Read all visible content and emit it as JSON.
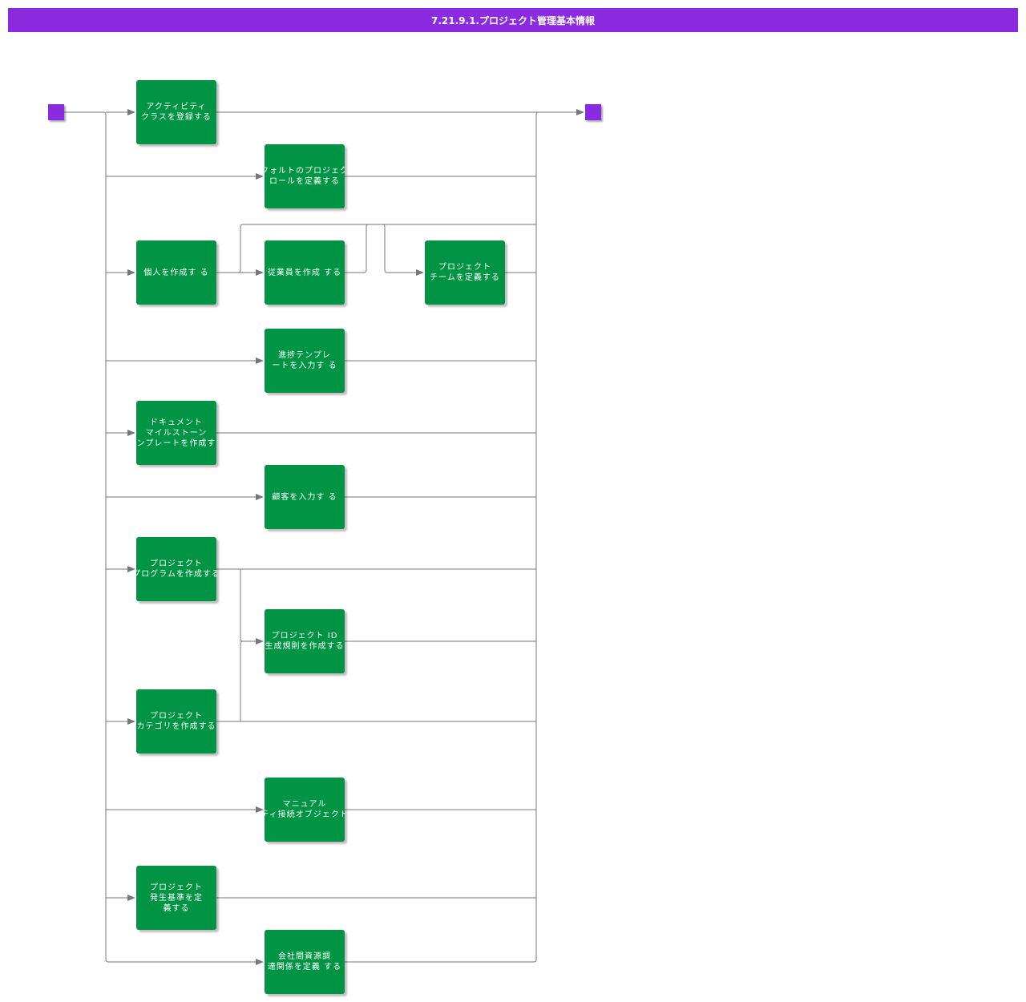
{
  "title": "7.21.9.1.プロジェクト管理基本情報",
  "colors": {
    "header": "#8a2be2",
    "task": "#009444",
    "terminal": "#8a2be2",
    "line": "#777777"
  },
  "nodes": [
    {
      "id": "start",
      "type": "start"
    },
    {
      "id": "end",
      "type": "end"
    },
    {
      "id": "t1",
      "label": "アクティビティ\nクラスを登録する"
    },
    {
      "id": "t2",
      "label": "フォルトのプロジェク\nロールを定義する"
    },
    {
      "id": "t3",
      "label": "個人を作成す る"
    },
    {
      "id": "t4",
      "label": "従業員を作成 する"
    },
    {
      "id": "t5",
      "label": "プロジェクト\nチームを定義する"
    },
    {
      "id": "t6",
      "label": "進捗テンプレ\nートを入力す る"
    },
    {
      "id": "t7",
      "label": "ドキュメント\nマイルストーン\nンプレートを作成す"
    },
    {
      "id": "t8",
      "label": "顧客を入力す る"
    },
    {
      "id": "t9",
      "label": "プロジェクト\nプログラムを作成する"
    },
    {
      "id": "t10",
      "label": "プロジェクト ID\n生成規則を作成する"
    },
    {
      "id": "t11",
      "label": "プロジェクト\nカテゴリを作成する"
    },
    {
      "id": "t12",
      "label": "マニュアル\nティ接続オブジェクト"
    },
    {
      "id": "t13",
      "label": "プロジェクト\n発生基準を定\n義する"
    },
    {
      "id": "t14",
      "label": "会社間資源調\n達関係を定義 する"
    }
  ],
  "edges": [
    [
      "start",
      "t1"
    ],
    [
      "start",
      "t2"
    ],
    [
      "start",
      "t3"
    ],
    [
      "start",
      "t6"
    ],
    [
      "start",
      "t7"
    ],
    [
      "start",
      "t8"
    ],
    [
      "start",
      "t9"
    ],
    [
      "start",
      "t11"
    ],
    [
      "start",
      "t12"
    ],
    [
      "start",
      "t13"
    ],
    [
      "start",
      "t14"
    ],
    [
      "t3",
      "t4"
    ],
    [
      "t4",
      "t5"
    ],
    [
      "t3",
      "t5"
    ],
    [
      "t9",
      "t10"
    ],
    [
      "t11",
      "t10"
    ],
    [
      "t1",
      "end"
    ],
    [
      "t2",
      "end"
    ],
    [
      "t3",
      "end"
    ],
    [
      "t4",
      "end"
    ],
    [
      "t5",
      "end"
    ],
    [
      "t6",
      "end"
    ],
    [
      "t7",
      "end"
    ],
    [
      "t8",
      "end"
    ],
    [
      "t9",
      "end"
    ],
    [
      "t10",
      "end"
    ],
    [
      "t11",
      "end"
    ],
    [
      "t12",
      "end"
    ],
    [
      "t13",
      "end"
    ],
    [
      "t14",
      "end"
    ]
  ]
}
